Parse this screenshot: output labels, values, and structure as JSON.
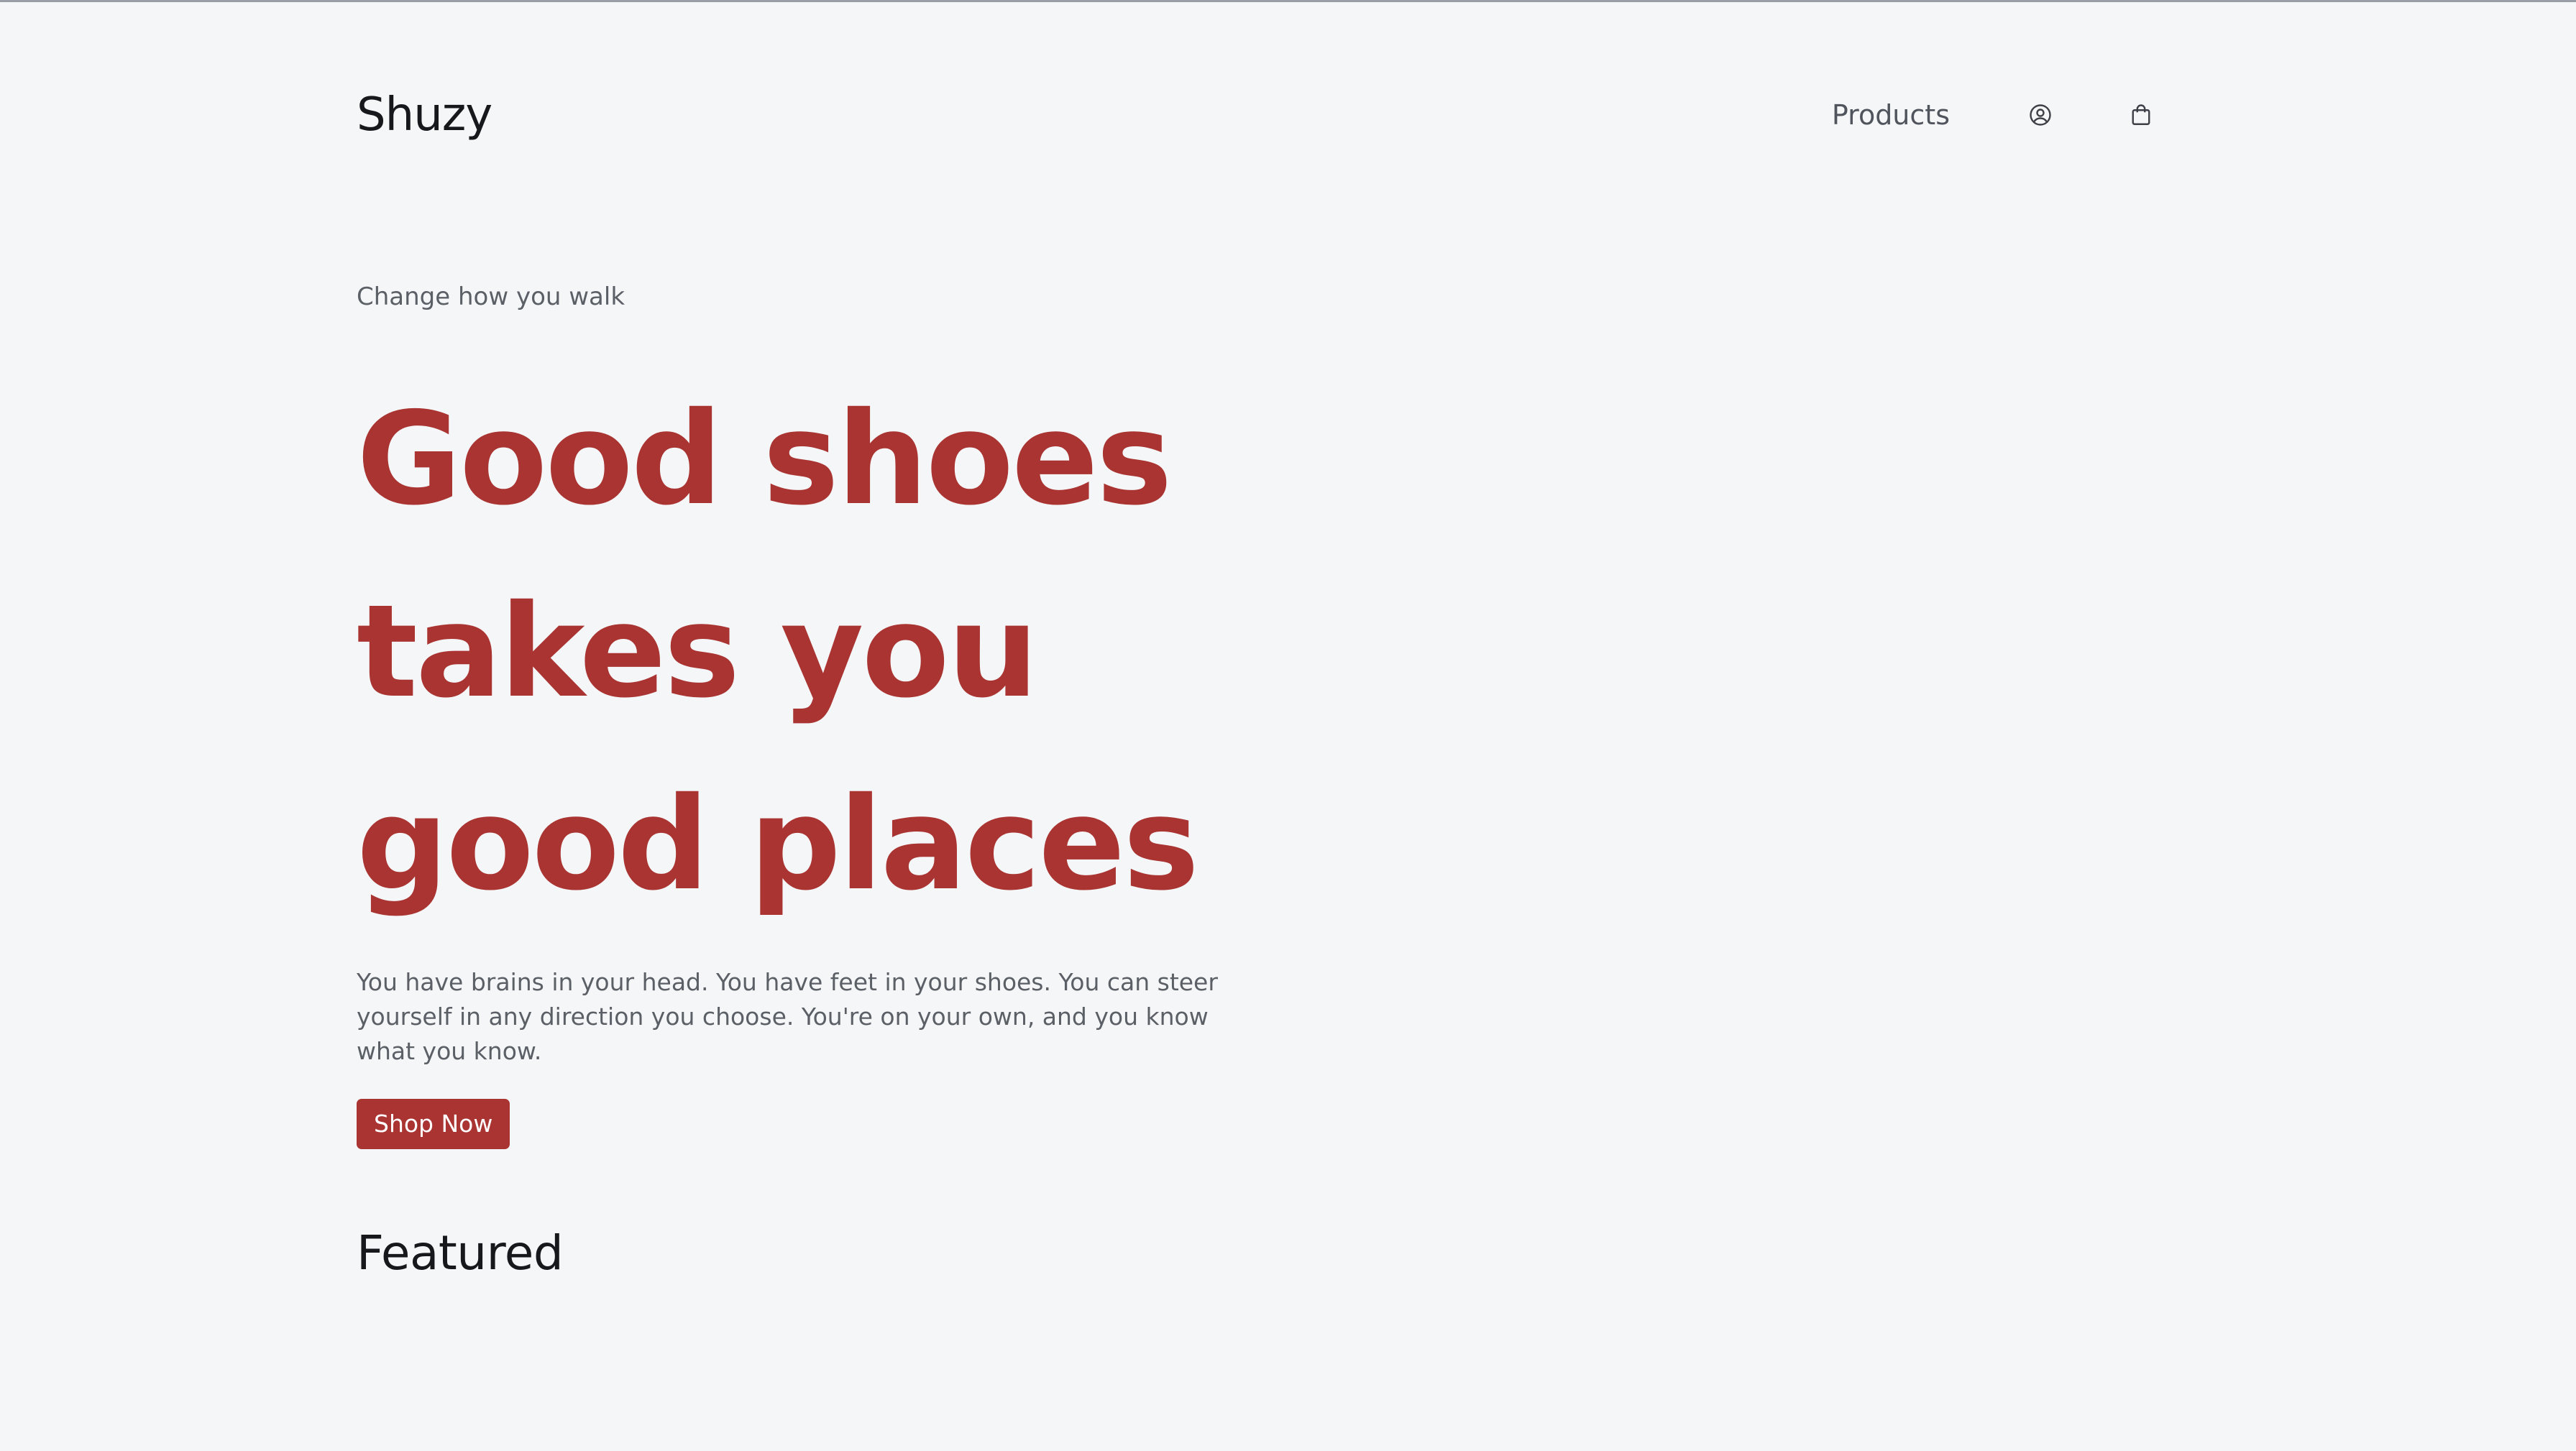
{
  "header": {
    "logo": "Shuzy",
    "nav_products": "Products",
    "account_icon": "user-circle-icon",
    "cart_icon": "shopping-bag-icon"
  },
  "hero": {
    "eyebrow": "Change how you walk",
    "headline_lines": [
      "Good shoes",
      "takes you",
      "good places"
    ],
    "lede": "You have brains in your head. You have feet in your shoes. You can steer yourself in any direction you choose. You're on your own, and you know what you know.",
    "cta_label": "Shop Now"
  },
  "featured": {
    "title": "Featured"
  },
  "colors": {
    "accent": "#a93431",
    "background": "#f5f6f8",
    "text_dark": "#16181c",
    "text_muted": "#5b5f66"
  }
}
